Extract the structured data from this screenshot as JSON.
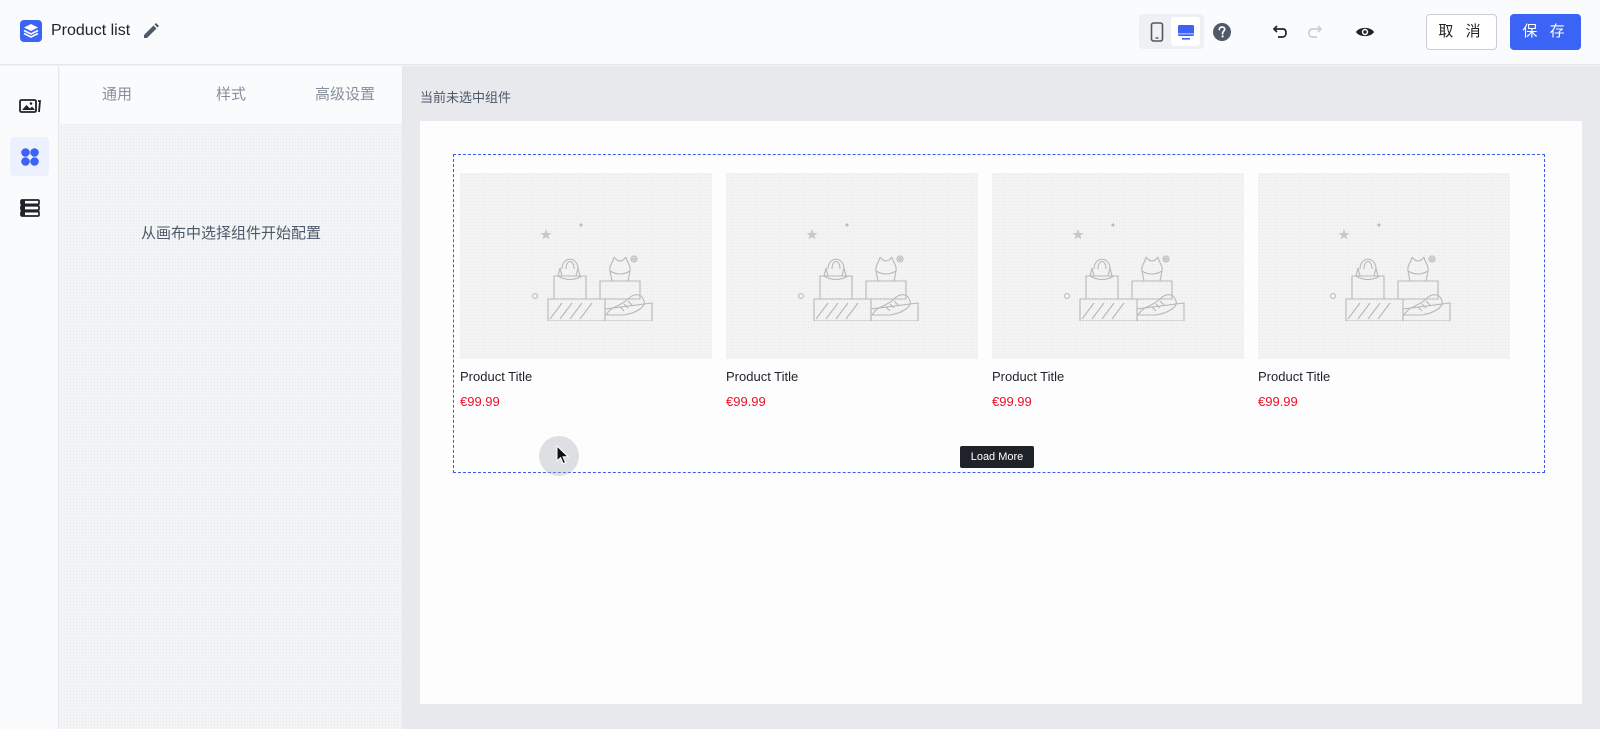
{
  "header": {
    "page_name": "Product list",
    "cancel_label": "取 消",
    "save_label": "保 存",
    "accent_color": "#3b63f5",
    "icons": [
      "layers-logo-icon",
      "pencil-edit-icon",
      "mobile-device-icon",
      "desktop-device-icon",
      "help-icon",
      "undo-icon",
      "redo-icon",
      "preview-eye-icon"
    ]
  },
  "rail": {
    "items": [
      {
        "name": "media-icon",
        "active": false
      },
      {
        "name": "components-icon",
        "active": true
      },
      {
        "name": "sections-icon",
        "active": false
      }
    ]
  },
  "panel": {
    "tabs": [
      "通用",
      "样式",
      "高级设置"
    ],
    "empty_message": "从画布中选择组件开始配置"
  },
  "canvas": {
    "hint": "当前未选中组件",
    "products": [
      {
        "title": "Product Title",
        "price": "€99.99"
      },
      {
        "title": "Product Title",
        "price": "€99.99"
      },
      {
        "title": "Product Title",
        "price": "€99.99"
      },
      {
        "title": "Product Title",
        "price": "€99.99"
      }
    ],
    "load_more_label": "Load More",
    "price_color": "#e8132c"
  }
}
